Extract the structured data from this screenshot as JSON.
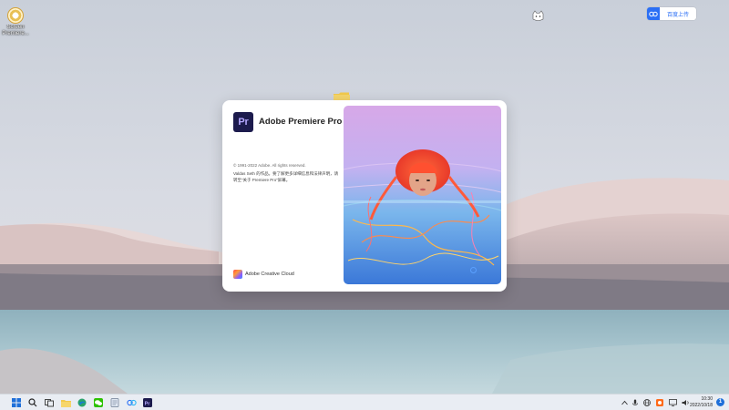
{
  "desktop": {
    "icon_label": "Screen Premiere...",
    "baidu_label": "百度上传"
  },
  "splash": {
    "logo_text": "Pr",
    "app_name": "Adobe Premiere Pro",
    "copyright": "© 1991-2022 Adobe. All rights reserved.",
    "credit": "Valdas Seth 的作品。要了解更多详细信息和法律声明，请转至“关于 Premiere Pro”屏幕。",
    "creative_cloud": "Adobe Creative Cloud"
  },
  "taskbar": {
    "time": "10:30",
    "date": "2022/10/18",
    "notification_count": "1",
    "apps": [
      "start",
      "search",
      "task-view",
      "file-explorer",
      "edge",
      "notepad",
      "baidu-netdisk",
      "premiere-pro"
    ]
  },
  "colors": {
    "premiere_bg": "#1c1b4d",
    "premiere_letters": "#b5a8ff",
    "accent_blue": "#2b6ff5",
    "windows_blue": "#1e6fd9"
  }
}
